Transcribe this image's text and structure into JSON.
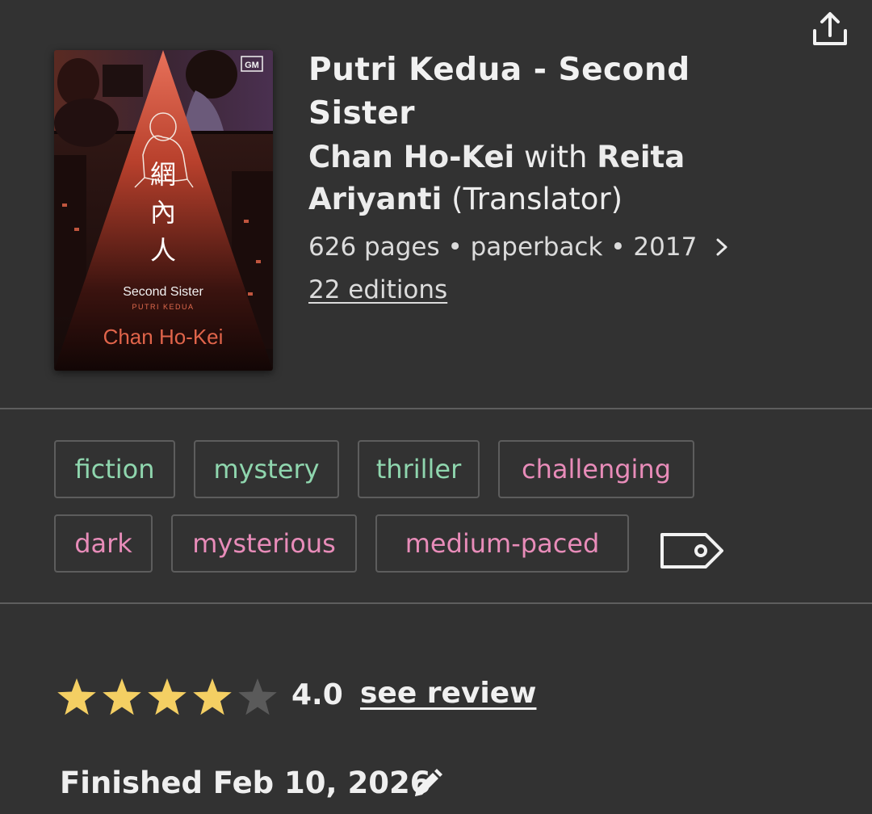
{
  "book": {
    "title": "Putri Kedua - Second Sister",
    "author_primary": "Chan Ho-Kei",
    "author_with": " with ",
    "author_secondary": "Reita Ariyanti",
    "author_secondary_role": " (Translator)",
    "meta": "626 pages • paperback • 2017",
    "editions_link": "22 editions"
  },
  "cover": {
    "publisher_logo": "GM",
    "chinese_title": [
      "網",
      "內",
      "人"
    ],
    "english_title": "Second Sister",
    "subtitle": "PUTRI KEDUA",
    "author": "Chan Ho-Kei"
  },
  "tags": {
    "genres": [
      "fiction",
      "mystery",
      "thriller"
    ],
    "moods": [
      "challenging",
      "dark",
      "mysterious",
      "medium-paced"
    ]
  },
  "review": {
    "rating": 4,
    "max_rating": 5,
    "rating_text": "4.0",
    "see_review_label": "see review"
  },
  "status": {
    "finished_text": "Finished Feb 10, 2026"
  },
  "icons": {
    "share": "share-icon",
    "chevron": "chevron-right-icon",
    "tag": "tag-icon",
    "star": "star-icon",
    "edit": "pencil-icon"
  },
  "colors": {
    "background": "#323232",
    "genre_tag": "#8fd6ae",
    "mood_tag": "#e88cb9",
    "star_filled": "#f4cf63",
    "star_empty": "#5a5a5a"
  }
}
